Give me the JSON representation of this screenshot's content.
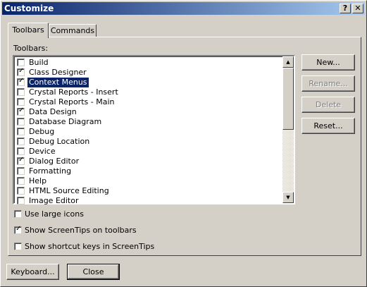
{
  "window": {
    "title": "Customize"
  },
  "titlebar": {
    "help_label": "?",
    "close_label": "✕"
  },
  "tabs": [
    {
      "label": "Toolbars",
      "active": true
    },
    {
      "label": "Commands",
      "active": false
    }
  ],
  "toolbars_label": "Toolbars:",
  "toolbar_items": [
    {
      "label": "Build",
      "checked": false,
      "selected": false
    },
    {
      "label": "Class Designer",
      "checked": true,
      "selected": false
    },
    {
      "label": "Context Menus",
      "checked": true,
      "selected": true
    },
    {
      "label": "Crystal Reports - Insert",
      "checked": false,
      "selected": false
    },
    {
      "label": "Crystal Reports - Main",
      "checked": false,
      "selected": false
    },
    {
      "label": "Data Design",
      "checked": true,
      "selected": false
    },
    {
      "label": "Database Diagram",
      "checked": false,
      "selected": false
    },
    {
      "label": "Debug",
      "checked": false,
      "selected": false
    },
    {
      "label": "Debug Location",
      "checked": false,
      "selected": false
    },
    {
      "label": "Device",
      "checked": false,
      "selected": false
    },
    {
      "label": "Dialog Editor",
      "checked": true,
      "selected": false
    },
    {
      "label": "Formatting",
      "checked": false,
      "selected": false
    },
    {
      "label": "Help",
      "checked": false,
      "selected": false
    },
    {
      "label": "HTML Source Editing",
      "checked": false,
      "selected": false
    },
    {
      "label": "Image Editor",
      "checked": false,
      "selected": false
    }
  ],
  "buttons": {
    "new": "New...",
    "rename": "Rename...",
    "delete": "Delete",
    "reset": "Reset...",
    "keyboard": "Keyboard...",
    "close": "Close"
  },
  "options": [
    {
      "label": "Use large icons",
      "checked": false
    },
    {
      "label": "Show ScreenTips on toolbars",
      "checked": true
    },
    {
      "label": "Show shortcut keys in ScreenTips",
      "checked": false
    }
  ],
  "check_glyph": "✓",
  "scroll": {
    "up_glyph": "▲",
    "down_glyph": "▼"
  }
}
